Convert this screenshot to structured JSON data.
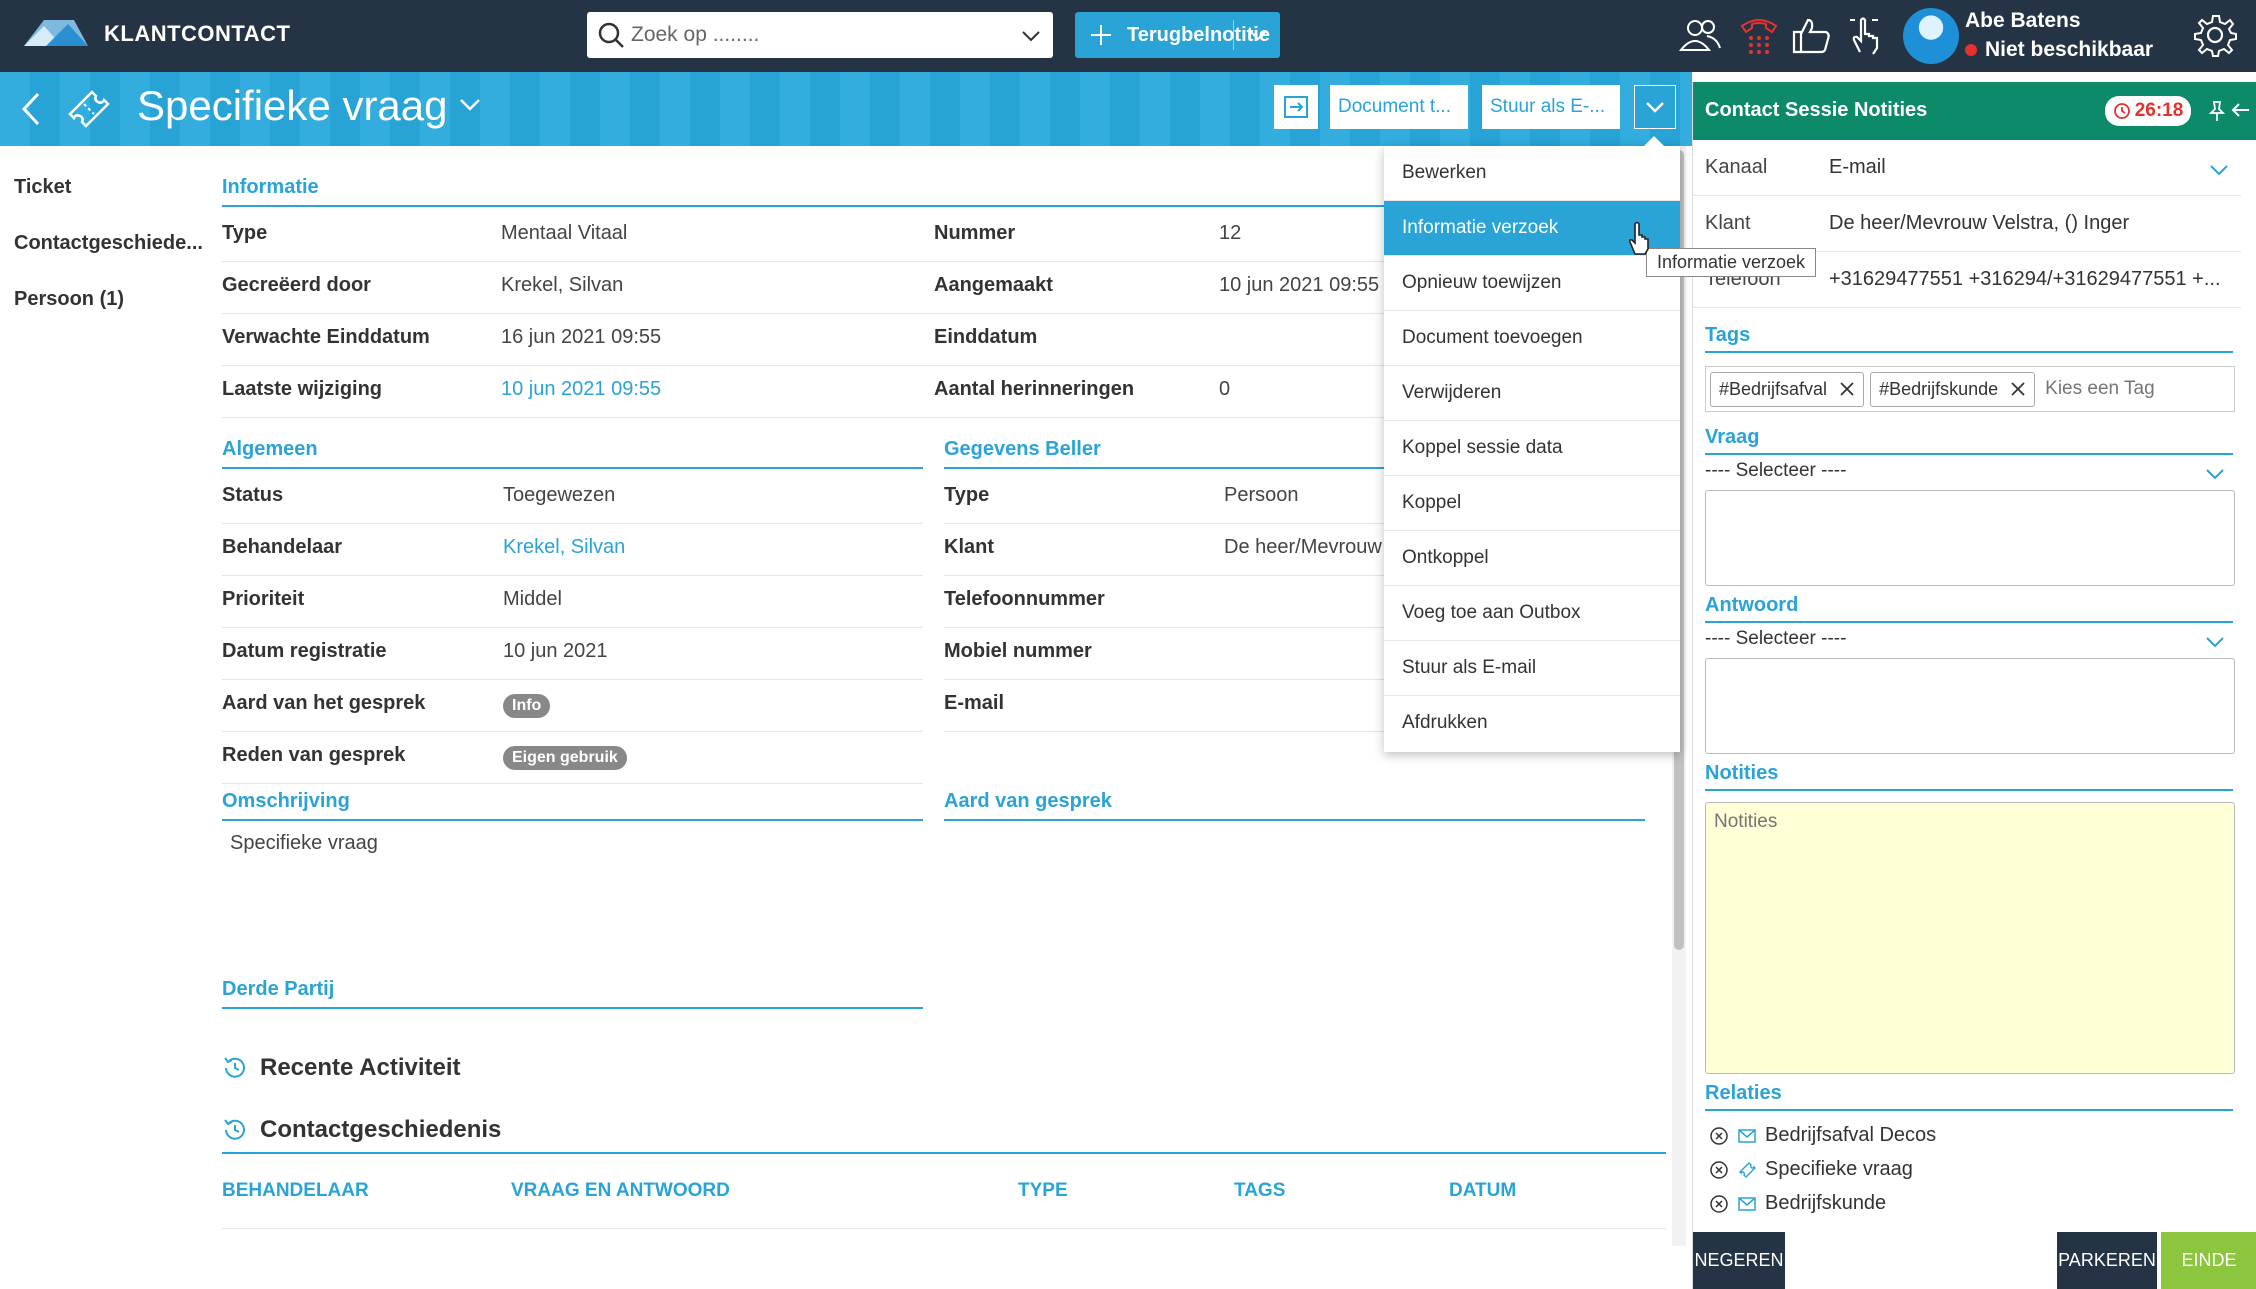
{
  "app": {
    "brand": "KLANTCONTACT"
  },
  "search": {
    "placeholder": "Zoek op ........"
  },
  "topbar": {
    "callback_button": "Terugbelnotitie",
    "user": {
      "name": "Abe Batens",
      "status": "Niet beschikbaar"
    }
  },
  "header": {
    "title": "Specifieke vraag",
    "btn_document": "Document t...",
    "btn_email": "Stuur als E-..."
  },
  "left_nav": [
    "Ticket",
    "Contactgeschiede...",
    "Persoon (1)"
  ],
  "informatie": {
    "heading": "Informatie",
    "left": [
      {
        "label": "Type",
        "value": "Mentaal Vitaal"
      },
      {
        "label": "Gecreëerd door",
        "value": "Krekel, Silvan"
      },
      {
        "label": "Verwachte Einddatum",
        "value": "16 jun 2021 09:55"
      },
      {
        "label": "Laatste wijziging",
        "value": "10 jun 2021 09:55"
      }
    ],
    "right": [
      {
        "label": "Nummer",
        "value": "12"
      },
      {
        "label": "Aangemaakt",
        "value": "10 jun 2021 09:55"
      },
      {
        "label": "Einddatum",
        "value": ""
      },
      {
        "label": "Aantal herinneringen",
        "value": "0"
      }
    ]
  },
  "algemeen": {
    "heading": "Algemeen",
    "rows": [
      {
        "label": "Status",
        "value": "Toegewezen"
      },
      {
        "label": "Behandelaar",
        "value": "Krekel, Silvan"
      },
      {
        "label": "Prioriteit",
        "value": "Middel"
      },
      {
        "label": "Datum registratie",
        "value": "10 jun 2021"
      },
      {
        "label": "Aard van het gesprek",
        "value": "Info"
      },
      {
        "label": "Reden van gesprek",
        "value": "Eigen gebruik"
      }
    ]
  },
  "beller": {
    "heading": "Gegevens Beller",
    "rows": [
      {
        "label": "Type",
        "value": "Persoon"
      },
      {
        "label": "Klant",
        "value": "De heer/Mevrouw"
      },
      {
        "label": "Telefoonnummer",
        "value": ""
      },
      {
        "label": "Mobiel nummer",
        "value": ""
      },
      {
        "label": "E-mail",
        "value": ""
      }
    ]
  },
  "omschrijving": {
    "heading": "Omschrijving",
    "text": "Specifieke vraag"
  },
  "aard": {
    "heading": "Aard van gesprek"
  },
  "derde": {
    "heading": "Derde Partij"
  },
  "activity": {
    "recent": "Recente Activiteit",
    "history": "Contactgeschiedenis"
  },
  "table": {
    "columns": [
      "BEHANDELAAR",
      "VRAAG EN ANTWOORD",
      "TYPE",
      "TAGS",
      "DATUM"
    ]
  },
  "menu": {
    "items": [
      "Bewerken",
      "Informatie verzoek",
      "Opnieuw toewijzen",
      "Document toevoegen",
      "Verwijderen",
      "Koppel sessie data",
      "Koppel",
      "Ontkoppel",
      "Voeg toe aan Outbox",
      "Stuur als E-mail",
      "Afdrukken"
    ],
    "highlighted_index": 1,
    "tooltip": "Informatie verzoek"
  },
  "panel": {
    "title": "Contact Sessie Notities",
    "timer": "26:18",
    "kanaal": {
      "label": "Kanaal",
      "value": "E-mail"
    },
    "klant": {
      "label": "Klant",
      "value": "De heer/Mevrouw Velstra, () Inger"
    },
    "telefoon": {
      "label": "Telefoon",
      "value": "+31629477551 +316294/+31629477551 +..."
    },
    "tags_heading": "Tags",
    "tags": [
      "#Bedrijfsafval",
      "#Bedrijfskunde"
    ],
    "tag_placeholder": "Kies een Tag",
    "vraag_heading": "Vraag",
    "vraag_select": "---- Selecteer ----",
    "antwoord_heading": "Antwoord",
    "antwoord_select": "---- Selecteer ----",
    "notities_heading": "Notities",
    "notities_placeholder": "Notities",
    "relaties_heading": "Relaties",
    "relaties": [
      {
        "icon": "mail-icon",
        "label": "Bedrijfsafval Decos"
      },
      {
        "icon": "ticket-icon",
        "label": "Specifieke vraag"
      },
      {
        "icon": "mail-icon",
        "label": "Bedrijfskunde"
      }
    ],
    "buttons": {
      "ignore": "NEGEREN",
      "park": "PARKEREN",
      "end": "EINDE"
    }
  },
  "colors": {
    "topbar": "#243444",
    "accent": "#2aa3d6",
    "panel_header": "#0c8a6a",
    "end_button": "#8cc63f",
    "notes_bg": "#ffffd8"
  }
}
